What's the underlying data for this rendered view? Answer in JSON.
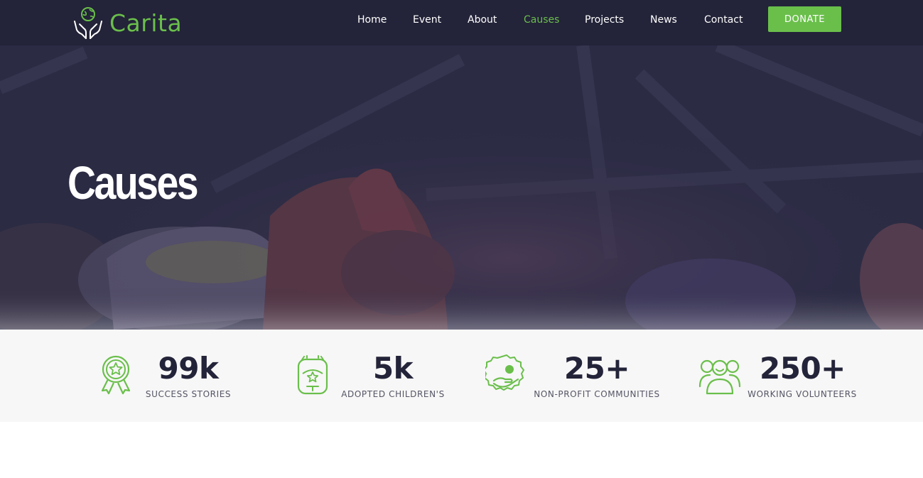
{
  "brand": {
    "name": "Carita",
    "logo_icon": "hands-globe-icon",
    "accent": "#6abf4b",
    "dark": "#232339"
  },
  "nav": {
    "items": [
      {
        "label": "Home",
        "active": false
      },
      {
        "label": "Event",
        "active": false
      },
      {
        "label": "About",
        "active": false
      },
      {
        "label": "Causes",
        "active": true
      },
      {
        "label": "Projects",
        "active": false
      },
      {
        "label": "News",
        "active": false
      },
      {
        "label": "Contact",
        "active": false
      }
    ],
    "donate_label": "DONATE"
  },
  "hero": {
    "title": "Causes"
  },
  "stats": [
    {
      "number": "99k",
      "label": "SUCCESS STORIES",
      "icon": "award-ribbon-icon"
    },
    {
      "number": "5k",
      "label": "ADOPTED CHILDREN'S",
      "icon": "backpack-icon"
    },
    {
      "number": "25+",
      "label": "NON-PROFIT COMMUNITIES",
      "icon": "charity-badge-icon"
    },
    {
      "number": "250+",
      "label": "WORKING VOLUNTEERS",
      "icon": "people-group-icon"
    }
  ]
}
